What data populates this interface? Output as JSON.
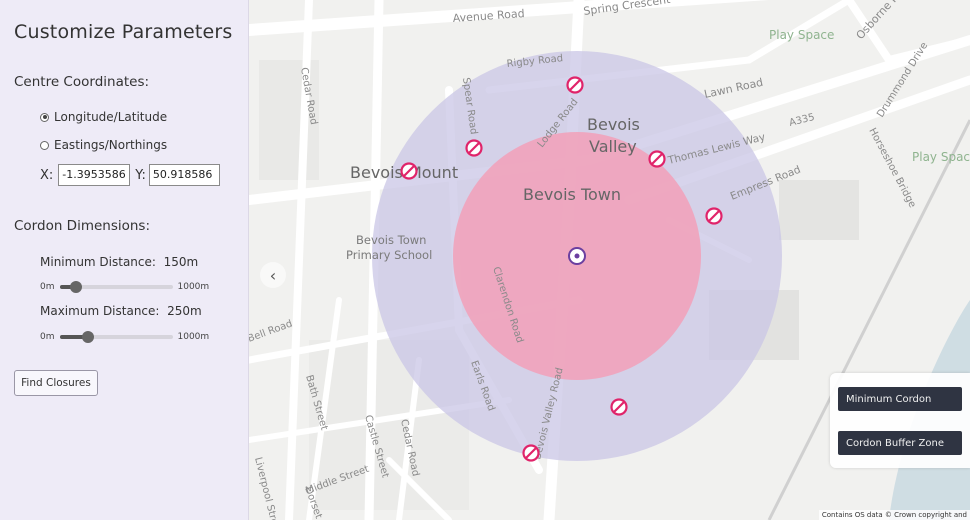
{
  "sidebar": {
    "title": "Customize Parameters",
    "centre_label": "Centre Coordinates:",
    "coord_modes": [
      {
        "label": "Longitude/Latitude",
        "selected": true
      },
      {
        "label": "Eastings/Northings",
        "selected": false
      }
    ],
    "x_label": "X:",
    "x_value": "-1.3953586",
    "y_label": "Y:",
    "y_value": "50.918586",
    "cordon_label": "Cordon Dimensions:",
    "min": {
      "label": "Minimum Distance:",
      "value": "150m",
      "fraction": 0.15,
      "range_min": "0m",
      "range_max": "1000m"
    },
    "max": {
      "label": "Maximum Distance:",
      "value": "250m",
      "fraction": 0.25,
      "range_min": "0m",
      "range_max": "1000m"
    },
    "find_button": "Find Closures"
  },
  "map": {
    "collapse_icon": "chevron-left-icon",
    "place_labels": {
      "bevois_valley_1": "Bevois",
      "bevois_valley_2": "Valley",
      "bevois_mount": "Bevois Mount",
      "bevois_town": "Bevois Town",
      "school_1": "Bevois Town",
      "school_2": "Primary School",
      "play_space_1": "Play Space",
      "play_space_2": "Play Space"
    },
    "road_labels": {
      "avenue_road": "Avenue Road",
      "spring_crescent": "Spring Crescent",
      "osborne_road": "Osborne Road",
      "rigby_road": "Rigby Road",
      "lawn_road": "Lawn Road",
      "drummond_drive": "Drummond Drive",
      "cedar_road": "Cedar Road",
      "spear_road": "Spear Road",
      "lodge_road": "Lodge Road",
      "thomas_lewis_way": "Thomas Lewis Way",
      "a335": "A335",
      "horseshoe_bridge": "Horseshoe Bridge",
      "empress_road": "Empress Road",
      "clarendon_road": "Clarendon Road",
      "earls_road": "Earls Road",
      "bevois_valley_road": "Bevois Valley Road",
      "bell_road": "Bell Road",
      "bath_street": "Bath Street",
      "castle_street": "Castle Street",
      "cedar_road_2": "Cedar Road",
      "middle_street": "Middle Street",
      "liverpool_street": "Liverpool Street",
      "dorset": "Dorset"
    },
    "legend": {
      "min_cordon": "Minimum Cordon",
      "buffer_zone": "Cordon Buffer Zone"
    },
    "attribution": "Contains OS data © Crown copyright and",
    "colors": {
      "inner_zone": "#f2a0b8",
      "outer_zone": "#c9c5e6",
      "closure_marker": "#e0246a",
      "centre_marker": "#6b3fa0"
    }
  }
}
